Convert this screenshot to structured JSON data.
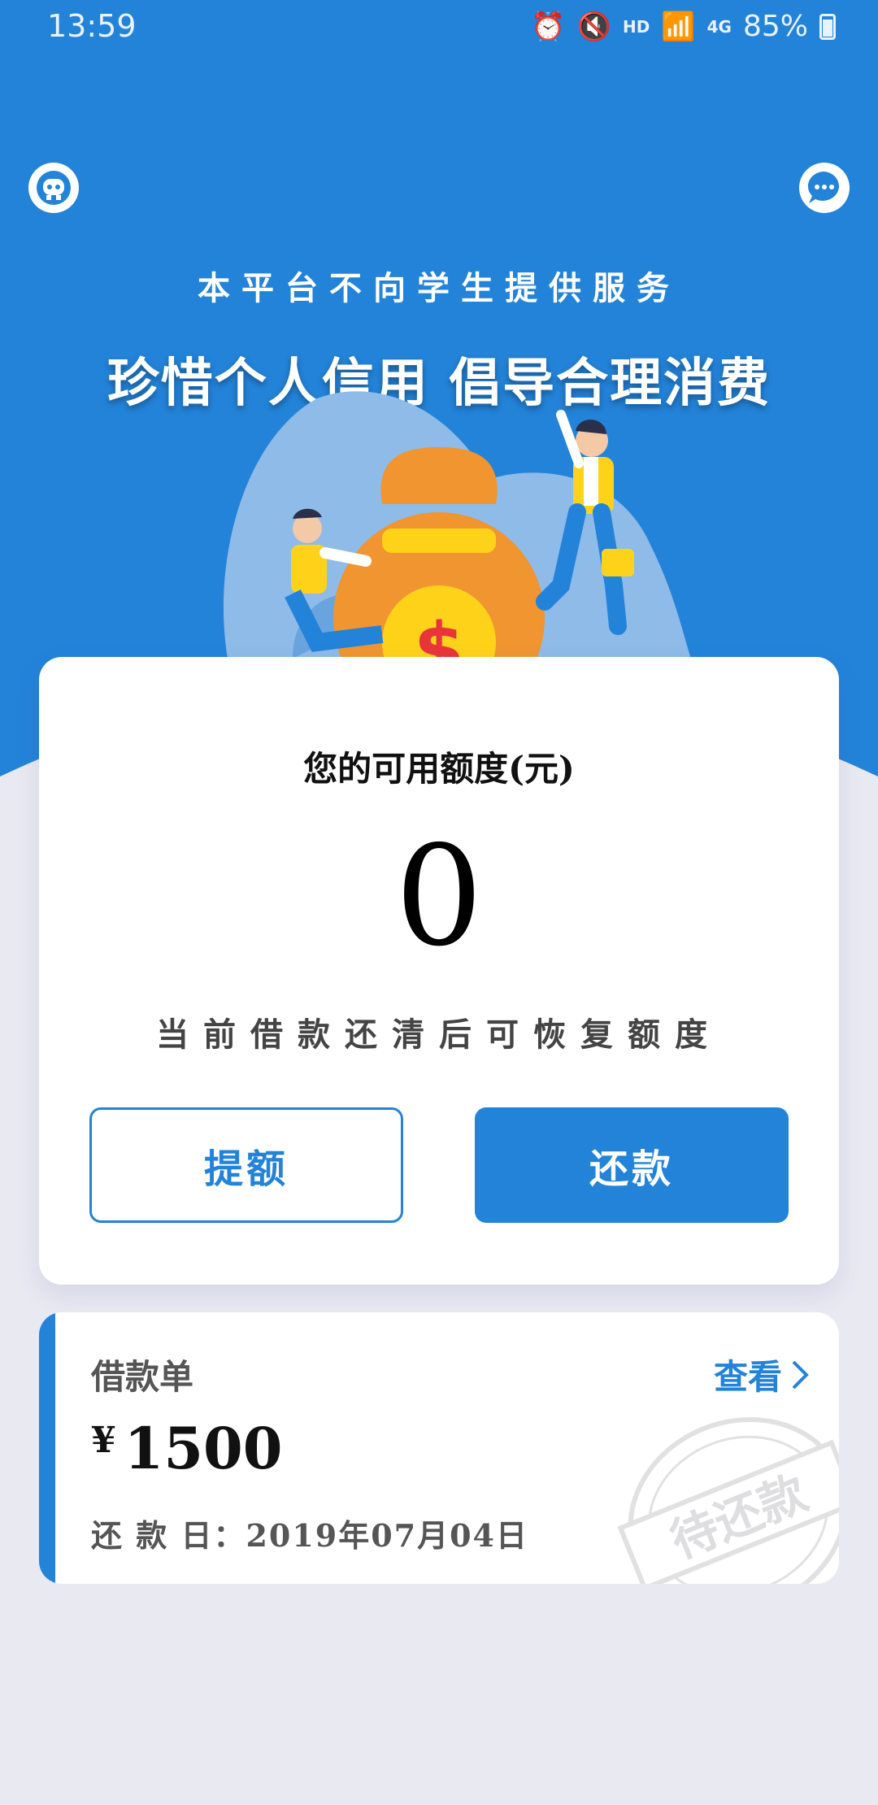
{
  "status_bar": {
    "time": "13:59",
    "network_label": "HD",
    "signal_label": "4G",
    "battery": "85%"
  },
  "header": {
    "notice": "本平台不向学生提供服务",
    "slogan": "珍惜个人信用 倡导合理消费"
  },
  "credit": {
    "label": "您的可用额度(元)",
    "amount": "0",
    "hint": "当前借款还清后可恢复额度",
    "raise_button": "提额",
    "repay_button": "还款"
  },
  "loan": {
    "title": "借款单",
    "view_link": "查看",
    "currency": "¥",
    "amount": "1500",
    "due_date": "还 款 日：2019年07月04日",
    "stamp_text": "待还款"
  },
  "colors": {
    "primary": "#2383d9",
    "background": "#e9e9f2",
    "card": "#ffffff"
  },
  "icons": {
    "robot": "robot-icon",
    "chat": "chat-icon",
    "arrow": "chevron-right-icon"
  }
}
